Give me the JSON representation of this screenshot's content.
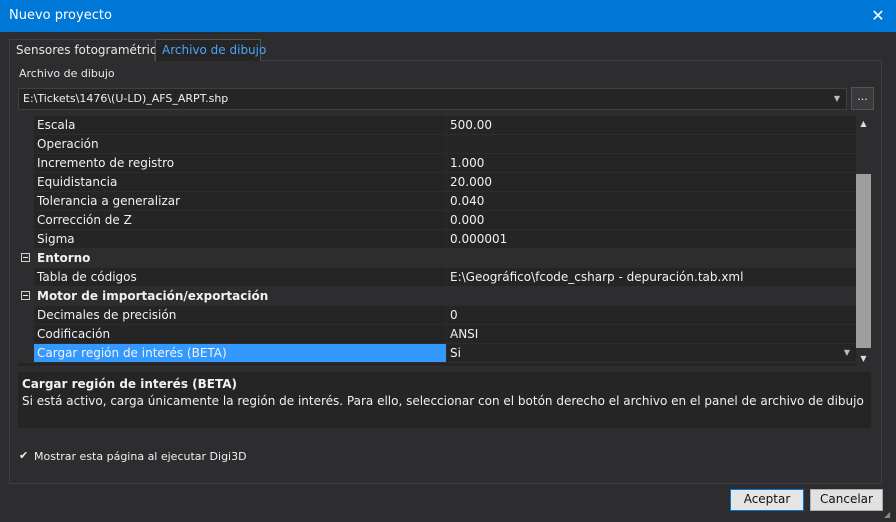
{
  "window": {
    "title": "Nuevo proyecto",
    "close_glyph": "✕"
  },
  "tabs": [
    {
      "label": "Sensores fotogramétricos",
      "active": false
    },
    {
      "label": "Archivo de dibujo",
      "active": true
    }
  ],
  "drawing_file": {
    "label": "Archivo de dibujo",
    "value": "E:\\Tickets\\1476\\(U-LD)_AFS_ARPT.shp",
    "browse_label": "..."
  },
  "property_grid": {
    "rows": [
      {
        "type": "prop",
        "name": "Escala",
        "value": "500.00"
      },
      {
        "type": "prop",
        "name": "Operación",
        "value": ""
      },
      {
        "type": "prop",
        "name": "Incremento de registro",
        "value": "1.000"
      },
      {
        "type": "prop",
        "name": "Equidistancia",
        "value": "20.000"
      },
      {
        "type": "prop",
        "name": "Tolerancia a generalizar",
        "value": "0.040"
      },
      {
        "type": "prop",
        "name": "Corrección de Z",
        "value": "0.000"
      },
      {
        "type": "prop",
        "name": "Sigma",
        "value": "0.000001"
      },
      {
        "type": "category",
        "name": "Entorno",
        "value": ""
      },
      {
        "type": "prop",
        "name": "Tabla de códigos",
        "value": "E:\\Geográfico\\fcode_csharp - depuración.tab.xml"
      },
      {
        "type": "category",
        "name": "Motor de importación/exportación",
        "value": ""
      },
      {
        "type": "prop",
        "name": "Decimales de precisión",
        "value": "0"
      },
      {
        "type": "prop",
        "name": "Codificación",
        "value": "ANSI"
      },
      {
        "type": "prop",
        "name": "Cargar región de interés (BETA)",
        "value": "Si",
        "selected": true
      }
    ]
  },
  "description": {
    "title": "Cargar región de interés (BETA)",
    "text": "Si está activo, carga únicamente la región de interés. Para ello, seleccionar con el botón derecho el archivo en el panel de archivo de dibujo"
  },
  "show_page_checkbox": {
    "label": "Mostrar esta página al ejecutar Digi3D",
    "checked": true
  },
  "buttons": {
    "accept": "Aceptar",
    "cancel": "Cancelar"
  },
  "colors": {
    "accent": "#0078d7",
    "selection": "#3399ff",
    "tab_active_text": "#4aa3ff"
  }
}
